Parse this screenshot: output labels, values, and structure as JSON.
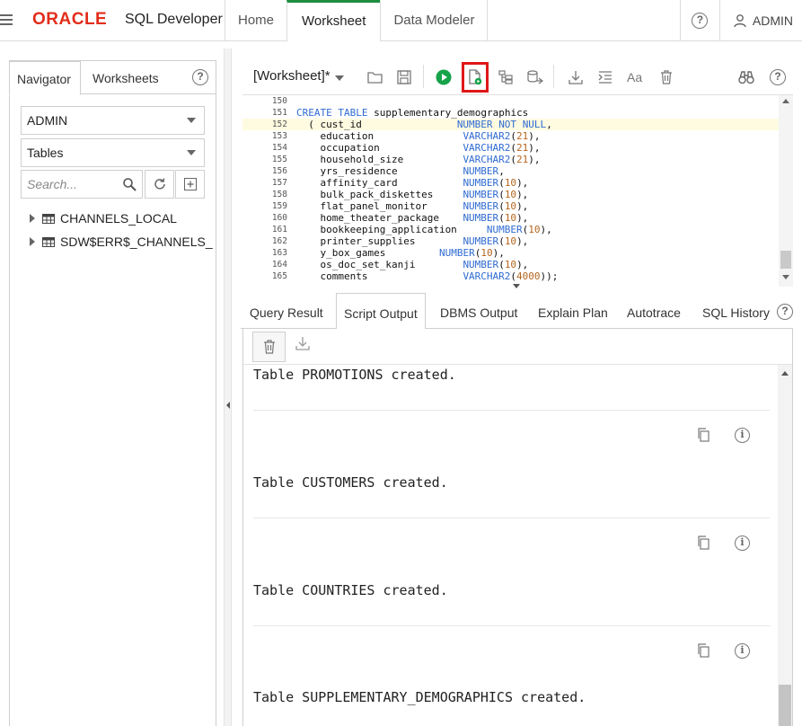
{
  "app": {
    "brand": "ORACLE",
    "product": "SQL Developer"
  },
  "top_tabs": [
    "Home",
    "Worksheet",
    "Data Modeler"
  ],
  "active_top_tab": "Worksheet",
  "user": {
    "name": "ADMIN"
  },
  "navigator": {
    "tabs": [
      "Navigator",
      "Worksheets"
    ],
    "schema": "ADMIN",
    "object_type": "Tables",
    "search_placeholder": "Search...",
    "items": [
      "CHANNELS_LOCAL",
      "SDW$ERR$_CHANNELS_"
    ]
  },
  "worksheet": {
    "title": "[Worksheet]*"
  },
  "editor": {
    "highlighted_line": "152",
    "lines": [
      {
        "n": "150",
        "code": ""
      },
      {
        "n": "151",
        "code": "CREATE TABLE supplementary_demographics"
      },
      {
        "n": "152",
        "code": "  ( cust_id                NUMBER NOT NULL,"
      },
      {
        "n": "153",
        "code": "    education               VARCHAR2(21),"
      },
      {
        "n": "154",
        "code": "    occupation              VARCHAR2(21),"
      },
      {
        "n": "155",
        "code": "    household_size          VARCHAR2(21),"
      },
      {
        "n": "156",
        "code": "    yrs_residence           NUMBER,"
      },
      {
        "n": "157",
        "code": "    affinity_card           NUMBER(10),"
      },
      {
        "n": "158",
        "code": "    bulk_pack_diskettes     NUMBER(10),"
      },
      {
        "n": "159",
        "code": "    flat_panel_monitor      NUMBER(10),"
      },
      {
        "n": "160",
        "code": "    home_theater_package    NUMBER(10),"
      },
      {
        "n": "161",
        "code": "    bookkeeping_application     NUMBER(10),"
      },
      {
        "n": "162",
        "code": "    printer_supplies        NUMBER(10),"
      },
      {
        "n": "163",
        "code": "    y_box_games         NUMBER(10),"
      },
      {
        "n": "164",
        "code": "    os_doc_set_kanji        NUMBER(10),"
      },
      {
        "n": "165",
        "code": "    comments                VARCHAR2(4000));"
      }
    ]
  },
  "output_tabs": [
    "Query Result",
    "Script Output",
    "DBMS Output",
    "Explain Plan",
    "Autotrace",
    "SQL History"
  ],
  "active_output_tab": "Script Output",
  "script_output": [
    "Table PROMOTIONS created.",
    "Table CUSTOMERS created.",
    "Table COUNTRIES created.",
    "Table SUPPLEMENTARY_DEMOGRAPHICS created."
  ],
  "colors": {
    "oracle_red": "#e22d1b",
    "active_tab_accent": "#1e8e3e",
    "run_green": "#16a34a",
    "highlight_red": "#e01818",
    "keyword_blue": "#2f6bd1",
    "number_orange": "#b5651d"
  }
}
